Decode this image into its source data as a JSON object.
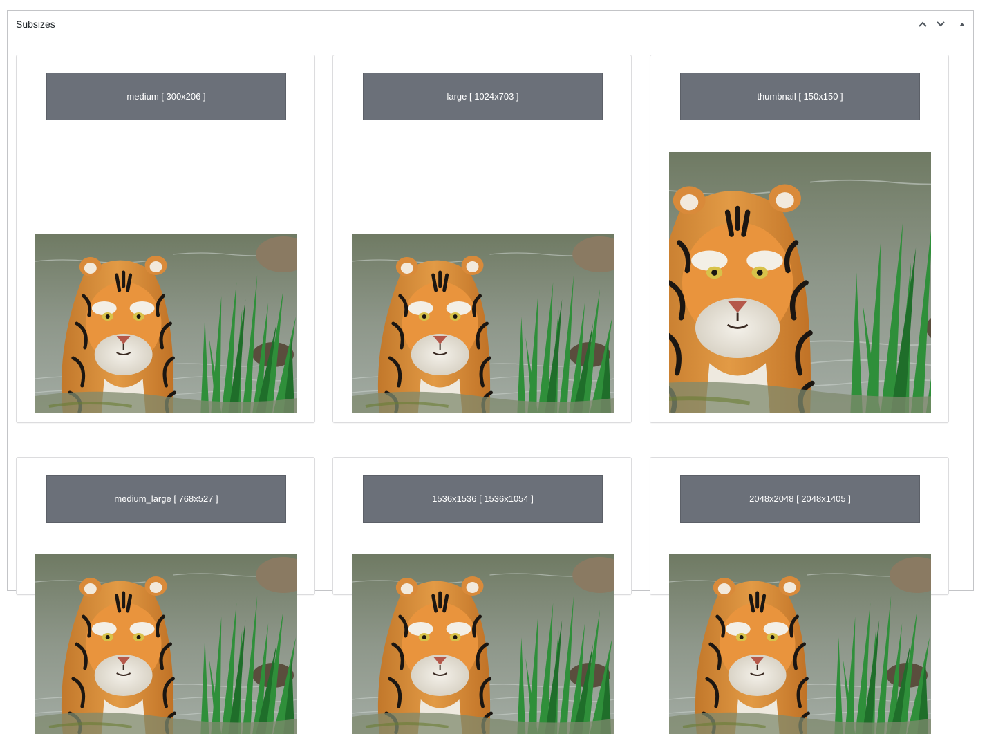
{
  "metabox": {
    "title": "Subsizes",
    "controls": {
      "move_up_icon": "chevron-up-icon",
      "move_down_icon": "chevron-down-icon",
      "toggle_icon": "triangle-up-icon"
    }
  },
  "subsizes": [
    {
      "name": "medium",
      "dims": "300x206",
      "label": "medium [ 300x206 ]"
    },
    {
      "name": "large",
      "dims": "1024x703",
      "label": "large [ 1024x703 ]"
    },
    {
      "name": "thumbnail",
      "dims": "150x150",
      "label": "thumbnail [ 150x150 ]"
    },
    {
      "name": "medium_large",
      "dims": "768x527",
      "label": "medium_large [ 768x527 ]"
    },
    {
      "name": "1536x1536",
      "dims": "1536x1054",
      "label": "1536x1536 [ 1536x1054 ]"
    },
    {
      "name": "2048x2048",
      "dims": "2048x1405",
      "label": "2048x2048 [ 2048x1405 ]"
    }
  ],
  "colors": {
    "label_bg": "#6b7079",
    "border": "#c3c4c7",
    "card_border": "#dcdcde"
  }
}
